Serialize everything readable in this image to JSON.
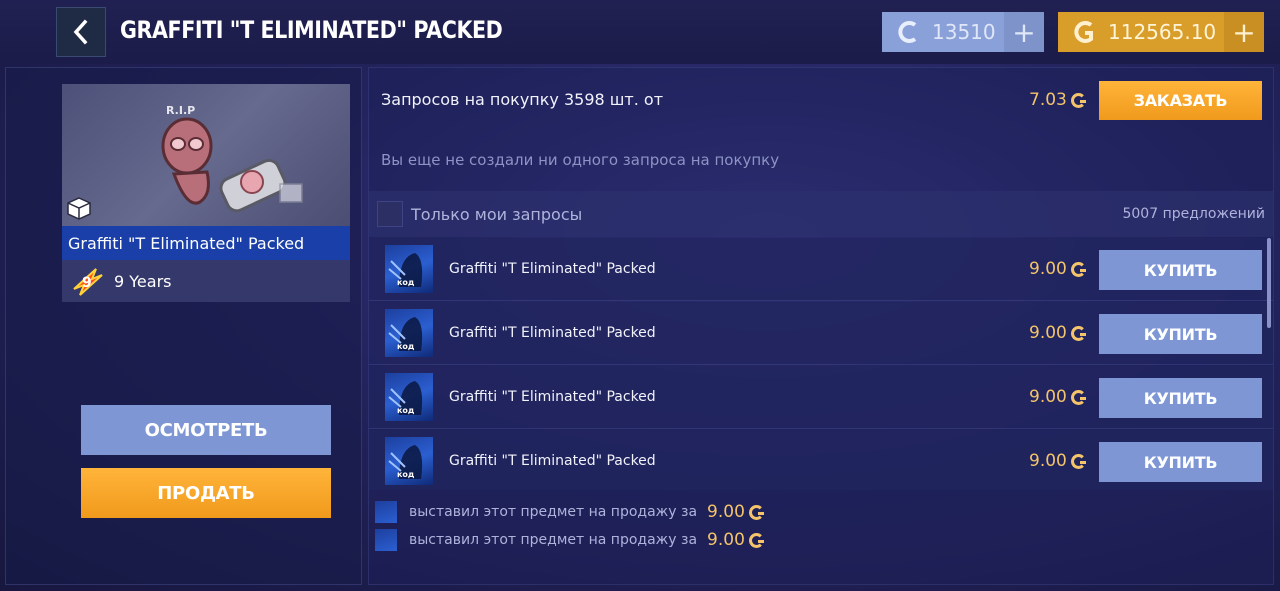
{
  "header": {
    "title": "GRAFFITI \"T ELIMINATED\" PACKED",
    "silver_balance": "13510",
    "gold_balance": "112565.10",
    "plus_label": "+"
  },
  "item": {
    "name": "Graffiti \"T Eliminated\" Packed",
    "collection": "9 Years",
    "view_button": "ОСМОТРЕТЬ",
    "sell_button": "ПРОДАТЬ"
  },
  "requests": {
    "text": "Запросов на покупку 3598 шт. от",
    "price": "7.03",
    "order_button": "ЗАКАЗАТЬ",
    "empty_message": "Вы еще не создали ни одного запроса на покупку"
  },
  "filter": {
    "only_mine_label": "Только мои запросы",
    "offers_count": "5007 предложений"
  },
  "offers": [
    {
      "thumb_label": "код",
      "name": "Graffiti \"T Eliminated\" Packed",
      "price": "9.00",
      "buy_label": "КУПИТЬ"
    },
    {
      "thumb_label": "код",
      "name": "Graffiti \"T Eliminated\" Packed",
      "price": "9.00",
      "buy_label": "КУПИТЬ"
    },
    {
      "thumb_label": "код",
      "name": "Graffiti \"T Eliminated\" Packed",
      "price": "9.00",
      "buy_label": "КУПИТЬ"
    },
    {
      "thumb_label": "код",
      "name": "Graffiti \"T Eliminated\" Packed",
      "price": "9.00",
      "buy_label": "КУПИТЬ"
    }
  ],
  "history": [
    {
      "text": "выставил этот предмет на продажу за",
      "price": "9.00"
    },
    {
      "text": "выставил этот предмет на продажу за",
      "price": "9.00"
    }
  ],
  "colors": {
    "accent_orange": "#f5a623",
    "button_blue": "#7e97d4",
    "gold_text": "#f4c36a",
    "name_bar": "#1a3fa8"
  },
  "icons": {
    "back": "chevron-left-icon",
    "silver_currency": "silver-coin-icon",
    "gold_currency": "gold-coin-icon",
    "item_type": "box-icon",
    "collection": "nine-years-badge-icon"
  }
}
